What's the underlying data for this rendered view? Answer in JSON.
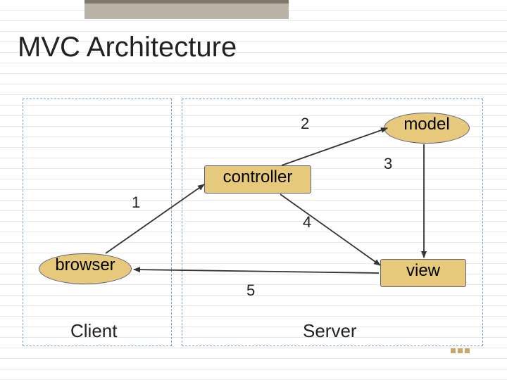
{
  "slide": {
    "title": "MVC Architecture",
    "client_label": "Client",
    "server_label": "Server"
  },
  "nodes": {
    "browser": "browser",
    "controller": "controller",
    "model": "model",
    "view": "view"
  },
  "edges": {
    "e1": "1",
    "e2": "2",
    "e3": "3",
    "e4": "4",
    "e5": "5"
  },
  "colors": {
    "node_fill": "#e6c97a",
    "dashed_border": "#7aa0bd",
    "topbar": "#b9b2a6"
  }
}
